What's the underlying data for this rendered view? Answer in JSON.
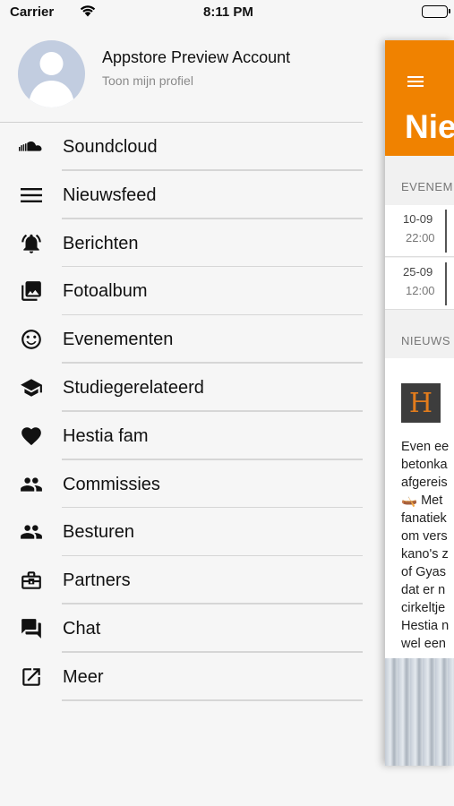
{
  "status_bar": {
    "carrier": "Carrier",
    "time": "8:11 PM"
  },
  "profile": {
    "name": "Appstore Preview Account",
    "subtitle": "Toon mijn profiel"
  },
  "menu": [
    {
      "label": "Soundcloud",
      "icon": "soundcloud-icon"
    },
    {
      "label": "Nieuwsfeed",
      "icon": "menu-lines-icon"
    },
    {
      "label": "Berichten",
      "icon": "bell-icon"
    },
    {
      "label": "Fotoalbum",
      "icon": "photo-album-icon"
    },
    {
      "label": "Evenementen",
      "icon": "smiley-icon"
    },
    {
      "label": "Studiegerelateerd",
      "icon": "graduation-cap-icon"
    },
    {
      "label": "Hestia fam",
      "icon": "heart-icon"
    },
    {
      "label": "Commissies",
      "icon": "people-icon"
    },
    {
      "label": "Besturen",
      "icon": "people-icon"
    },
    {
      "label": "Partners",
      "icon": "briefcase-icon"
    },
    {
      "label": "Chat",
      "icon": "chat-icon"
    },
    {
      "label": "Meer",
      "icon": "external-link-icon"
    }
  ],
  "main_panel": {
    "title": "Nie",
    "events_label": "EVENEM",
    "events": [
      {
        "date": "10-09",
        "time": "22:00"
      },
      {
        "date": "25-09",
        "time": "12:00"
      }
    ],
    "news_label": "NIEUWS",
    "news_logo": "H",
    "news_text": "Even ee\nbetonka\nafgereis\n🛶 Met\nfanatiek\nom vers\nkano's z\nof Gyas\ndat er n\ncirkeltje\nHestia n\nwel een"
  },
  "colors": {
    "accent": "#f08200",
    "background": "#f6f6f6"
  }
}
